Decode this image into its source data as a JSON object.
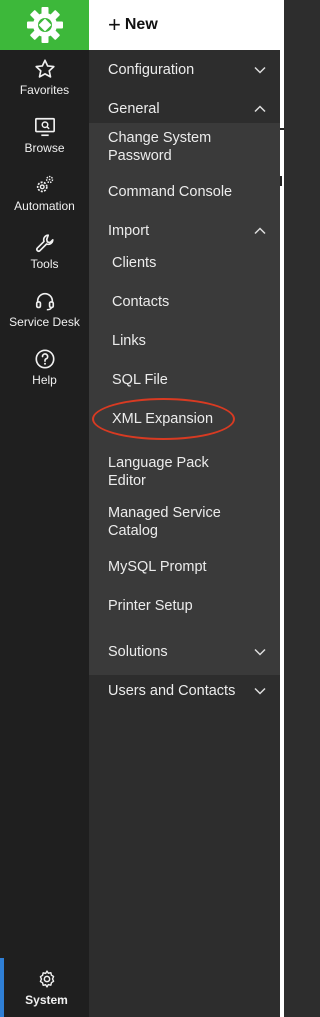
{
  "topbar": {
    "new_label": "New"
  },
  "rail": {
    "items": [
      {
        "label": "Favorites",
        "icon": "star-icon"
      },
      {
        "label": "Browse",
        "icon": "monitor-search-icon"
      },
      {
        "label": "Automation",
        "icon": "gears-icon"
      },
      {
        "label": "Tools",
        "icon": "wrench-icon"
      },
      {
        "label": "Service Desk",
        "icon": "headset-icon"
      },
      {
        "label": "Help",
        "icon": "help-icon"
      }
    ],
    "system_label": "System"
  },
  "menu": {
    "configuration": "Configuration",
    "general": "General",
    "general_items": [
      "Change System Password",
      "Command Console"
    ],
    "import": "Import",
    "import_items": [
      "Clients",
      "Contacts",
      "Links",
      "SQL File",
      "XML Expansion"
    ],
    "more_items": [
      "Language Pack Editor",
      "Managed Service Catalog",
      "MySQL Prompt",
      "Printer Setup"
    ],
    "solutions": "Solutions",
    "users_and_contacts": "Users and Contacts"
  },
  "colors": {
    "brand_green": "#3db83a",
    "active_blue": "#2f7fd6",
    "annotation_red": "#d83a22"
  }
}
